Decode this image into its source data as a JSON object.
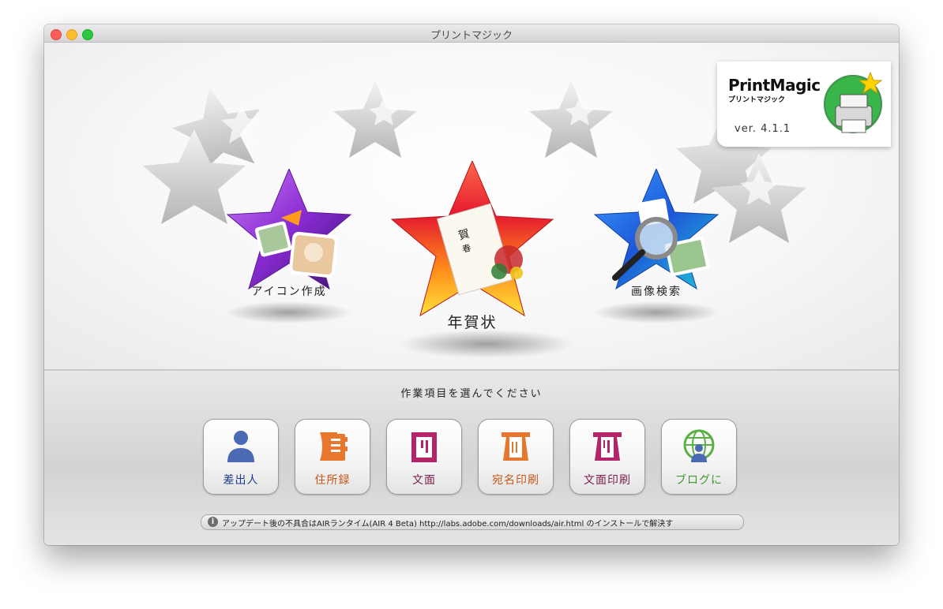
{
  "window": {
    "title": "プリントマジック"
  },
  "logo": {
    "name": "PrintMagic",
    "subtitle": "プリントマジック",
    "version": "ver. 4.1.1"
  },
  "features": {
    "icon_maker": {
      "label": "アイコン作成",
      "icon": "photo-collage-icon"
    },
    "new_year_card": {
      "label": "年賀状",
      "icon": "new-year-card-icon"
    },
    "image_search": {
      "label": "画像検索",
      "icon": "magnifier-photo-icon"
    }
  },
  "lower": {
    "prompt": "作業項目を選んでください"
  },
  "buttons": [
    {
      "label": "差出人",
      "icon": "person-icon",
      "color": "#1f3a93"
    },
    {
      "label": "住所録",
      "icon": "address-book-icon",
      "color": "#c8561a"
    },
    {
      "label": "文面",
      "icon": "card-design-icon",
      "color": "#7a1d4d"
    },
    {
      "label": "宛名印刷",
      "icon": "address-print-icon",
      "color": "#c8561a"
    },
    {
      "label": "文面印刷",
      "icon": "card-print-icon",
      "color": "#7a1d4d"
    },
    {
      "label": "ブログに",
      "icon": "globe-person-icon",
      "color": "#3e9a2b"
    }
  ],
  "info": {
    "icon": "info-icon",
    "text": "アップデート後の不具合はAIRランタイム(AIR 4 Beta) http://labs.adobe.com/downloads/air.html のインストールで解決す"
  }
}
